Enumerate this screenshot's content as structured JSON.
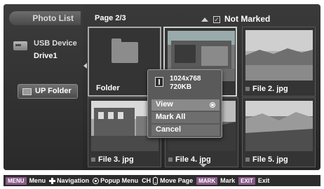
{
  "sidebar": {
    "title": "Photo List",
    "device_label": "USB Device",
    "drive_label": "Drive1",
    "up_folder_label": "UP Folder",
    "icons": {
      "device": "usb-drive-icon",
      "up_folder": "folder-icon"
    }
  },
  "header": {
    "page": "Page 2/3",
    "mark_status": "Not Marked"
  },
  "thumbnails": [
    {
      "label": "Folder",
      "kind": "folder"
    },
    {
      "label": "",
      "kind": "photo"
    },
    {
      "label": "File 2. jpg",
      "kind": "photo"
    },
    {
      "label": "File 3. jpg",
      "kind": "photo"
    },
    {
      "label": "File 4. jpg",
      "kind": "photo"
    },
    {
      "label": "File 5. jpg",
      "kind": "photo"
    }
  ],
  "popup": {
    "resolution": "1024x768",
    "size": "720KB",
    "items": [
      {
        "label": "View",
        "selected": true
      },
      {
        "label": "Mark All",
        "selected": false
      },
      {
        "label": "Cancel",
        "selected": false
      }
    ]
  },
  "footer": {
    "menu_key": "MENU",
    "menu_label": "Menu",
    "navigation_label": "Navigation",
    "popup_label": "Popup Menu",
    "ch_label": "CH",
    "move_page_label": "Move Page",
    "mark_key": "MARK",
    "mark_label": "Mark",
    "exit_key": "EXIT",
    "exit_label": "Exit"
  },
  "colors": {
    "key_background": "#8b5a8a",
    "panel_background": "#2a2a2a",
    "popup_background": "#5a5a5a"
  }
}
